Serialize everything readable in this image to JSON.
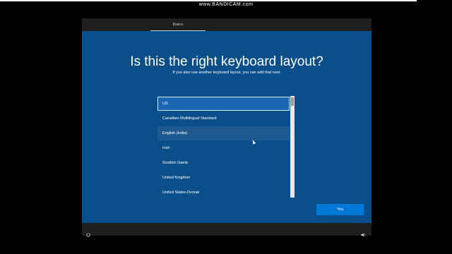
{
  "watermark": "www.BANDICAM.com",
  "header": {
    "tab_label": "Basics"
  },
  "main": {
    "title": "Is this the right keyboard layout?",
    "subtitle": "If you also use another keyboard layout, you can add that next.",
    "layouts": [
      "US",
      "Canadian Multilingual Standard",
      "English (India)",
      "Irish",
      "Scottish Gaelic",
      "United Kingdom",
      "United States-Dvorak"
    ],
    "selected_layout": "US",
    "yes_label": "Yes"
  },
  "footer": {
    "left_icon": "ease-of-access-icon",
    "right_icon": "volume-icon"
  },
  "colors": {
    "content_bg": "#0b4f8a",
    "selected_bg": "#1a67b3",
    "button_bg": "#0078d7",
    "chrome_bg": "#1f1f1f"
  }
}
